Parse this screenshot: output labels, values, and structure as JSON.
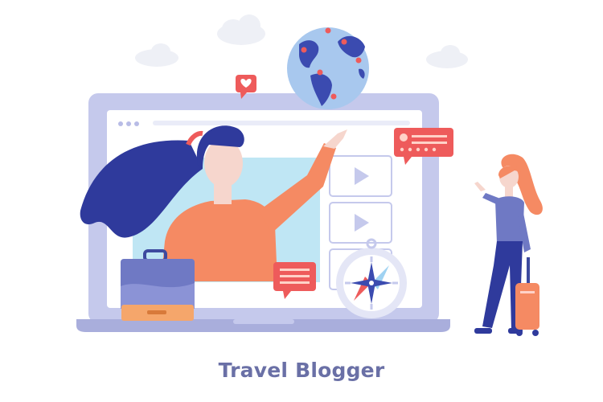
{
  "caption": "Travel Blogger",
  "colors": {
    "frame": "#c5c9ec",
    "frame_dark": "#a9aedc",
    "screen_bg": "#ffffff",
    "video_bg": "#bfe6f4",
    "hair": "#2f3a9c",
    "skin": "#f6d6cd",
    "top": "#f58a63",
    "accent": "#ee5b5b",
    "suitcase": "#6f79c4",
    "suitcase_base": "#f5a66b",
    "globe": "#a8c8ee",
    "continents": "#3b4bb0",
    "cloud": "#eef0f6",
    "caption": "#6a70a6"
  },
  "icons": [
    "heart-bubble-icon",
    "rating-bubble-icon",
    "chat-bubble-icon",
    "play-icon",
    "compass-icon",
    "globe-icon",
    "suitcase-icon",
    "rolling-luggage-icon",
    "cloud-icon"
  ]
}
